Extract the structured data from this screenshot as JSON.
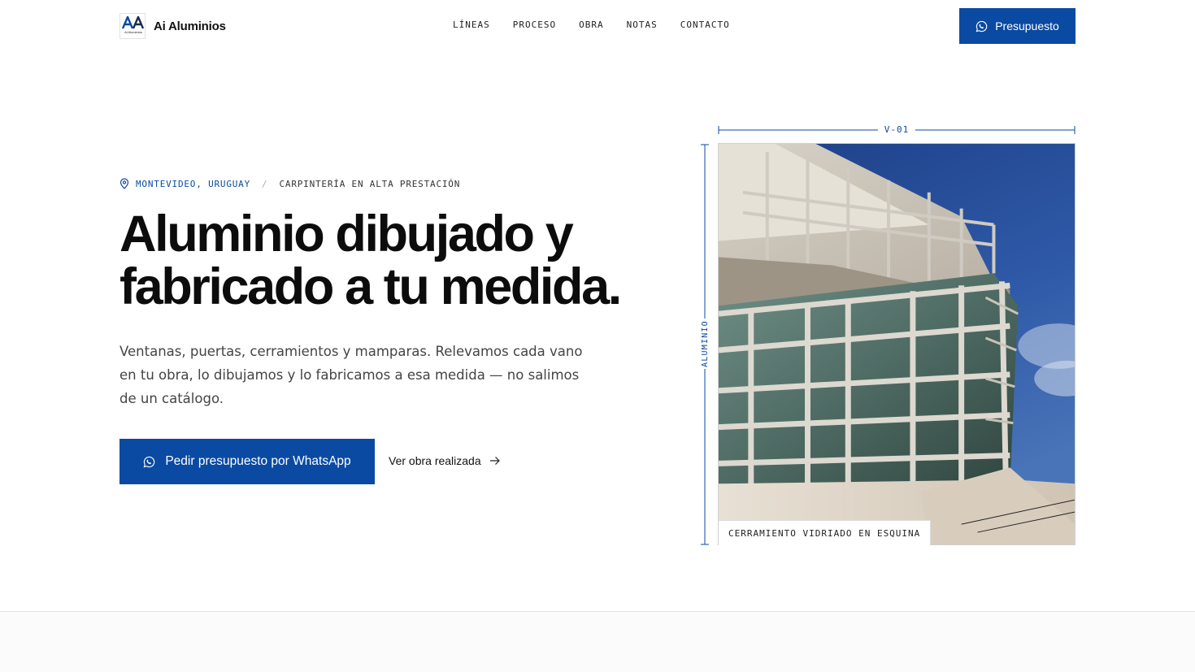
{
  "brand": {
    "name": "Ai Aluminios",
    "logo_subtext": "Ai Aluminios"
  },
  "nav": {
    "items": [
      {
        "label": "LÍNEAS"
      },
      {
        "label": "PROCESO"
      },
      {
        "label": "OBRA"
      },
      {
        "label": "NOTAS"
      },
      {
        "label": "CONTACTO"
      }
    ]
  },
  "header": {
    "cta_label": "Presupuesto"
  },
  "hero": {
    "location": "MONTEVIDEO, URUGUAY",
    "separator": "/",
    "tagline": "CARPINTERÍA EN ALTA PRESTACIÓN",
    "headline_line1": "Aluminio dibujado y",
    "headline_line2": "fabricado a tu medida.",
    "lead": "Ventanas, puertas, cerramientos y mamparas. Relevamos cada vano en tu obra, lo dibujamos y lo fabricamos a esa medida — no salimos de un catálogo.",
    "primary_cta": "Pedir presupuesto por WhatsApp",
    "secondary_cta": "Ver obra realizada"
  },
  "figure": {
    "dimension_top": "V-01",
    "dimension_side": "ALUMINIO",
    "caption": "CERRAMIENTO VIDRIADO EN ESQUINA"
  },
  "colors": {
    "accent": "#0b4aa2",
    "text": "#111111",
    "muted": "#444444"
  },
  "icons": {
    "whatsapp": "whatsapp-icon",
    "pin": "map-pin-icon",
    "arrow": "arrow-right-icon"
  }
}
